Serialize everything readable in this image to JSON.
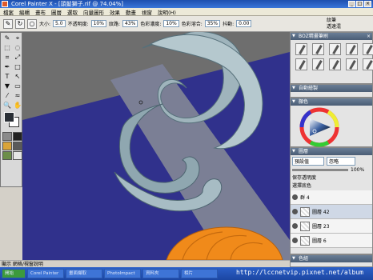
{
  "window": {
    "title": "Corel Painter X - [頭髮獅子.rif @ 74.04%]",
    "controls": [
      "_",
      "□",
      "×"
    ]
  },
  "menu": [
    "檔案",
    "編輯",
    "畫布",
    "圖層",
    "選取",
    "向量圖形",
    "效果",
    "動畫",
    "視窗",
    "說明(H)"
  ],
  "propbar": {
    "size_label": "大小:",
    "size_value": "5.0",
    "opacity_label": "不透明度:",
    "opacity_value": "10%",
    "grain_label": "紋路:",
    "grain_value": "43%",
    "resat_label": "色彩濃度:",
    "resat_value": "10%",
    "bleed_label": "色彩溶合:",
    "bleed_value": "35%",
    "jitter_label": "抖動:",
    "jitter_value": "0.00",
    "right_label_1": "紋筆",
    "right_label_2": "透速混"
  },
  "panels": {
    "brushes": {
      "title": "BOZ精畫筆刷"
    },
    "auto_paint": {
      "title": "自動繪製"
    },
    "colors": {
      "title": "顏色"
    },
    "layers": {
      "title": "圖層",
      "blend_mode": "預設值",
      "composite": "忽略",
      "opacity": "100%",
      "preserve_transparency": "保存透明度",
      "pick_up_color": "選擇底色",
      "rows": [
        {
          "name": "群 4"
        },
        {
          "name": "圖層 42"
        },
        {
          "name": "圖層 23"
        },
        {
          "name": "圖層 6"
        }
      ]
    },
    "color_sets": {
      "title": "色組"
    }
  },
  "status": "顯示 網格/視窗說明",
  "taskbar": {
    "items": [
      "開始",
      "Corel Painter",
      "畫面擷取",
      "PhotoImpact",
      "資料夾",
      "相片"
    ],
    "watermark": "http://lccnetvip.pixnet.net/album"
  },
  "colors": {
    "canvas_gray": "#6e6e6e",
    "background_blue": "#30318c",
    "hair": "#9fb4bc",
    "orange": "#f08a1a"
  }
}
